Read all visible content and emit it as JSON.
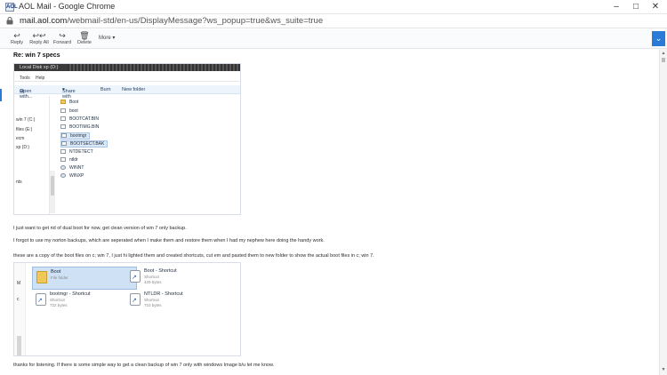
{
  "window": {
    "logo": "AOL",
    "title": "AOL Mail - Google Chrome",
    "url_host": "mail.aol.com",
    "url_path": "/webmail-std/en-us/DisplayMessage?ws_popup=true&ws_suite=true"
  },
  "toolbar": {
    "reply": "Reply",
    "reply_all": "Reply All",
    "forward": "Forward",
    "delete": "Delete",
    "more": "More"
  },
  "message": {
    "subject": "Re: win 7 specs",
    "line1": "I just want to get rid of dual boot for now, get clean version of win 7 only backup.",
    "line2": "I forgot to use my norton backups, which are seperated when I make them and restore them when I had my nephew here doing the handy work.",
    "line3": "these are a copy of the boot files on c; win 7, I just hi lighted them and created shortcuts, cut em and pasted them to new folder to show the actual boot files in c; win 7.",
    "line4": "thanks for listening. If there is some simple way to get a clean backup of win 7 only with windows Image b/u let me know."
  },
  "shot1": {
    "header": "Local Disk xp (D:)",
    "menu": [
      "Tools",
      "Help"
    ],
    "commands": [
      "Open with...",
      "Share with",
      "Burn",
      "New folder"
    ],
    "nav": [
      "win 7 (C:)",
      "files (E:)",
      "ecm",
      "xp (D:)",
      "nts"
    ],
    "files": [
      {
        "name": "Boot",
        "type": "folder",
        "selected": false
      },
      {
        "name": "boot",
        "type": "doc",
        "selected": false
      },
      {
        "name": "BOOTCAT.BIN",
        "type": "doc",
        "selected": false
      },
      {
        "name": "BOOTIMG.BIN",
        "type": "doc",
        "selected": false
      },
      {
        "name": "bootmgr",
        "type": "doc",
        "selected": true
      },
      {
        "name": "BOOTSECT.BAK",
        "type": "doc",
        "selected": true
      },
      {
        "name": "NTDETECT",
        "type": "doc",
        "selected": false
      },
      {
        "name": "ntldr",
        "type": "doc",
        "selected": false
      },
      {
        "name": "WINNT",
        "type": "sys",
        "selected": false
      },
      {
        "name": "WINXP",
        "type": "sys",
        "selected": false
      }
    ]
  },
  "shot2": {
    "side_labels": [
      "M",
      "c"
    ],
    "tiles": [
      {
        "name": "Boot",
        "sub": "File folder",
        "size": "",
        "icon": "folder",
        "selected": true
      },
      {
        "name": "Boot - Shortcut",
        "sub": "Shortcut",
        "size": "429 bytes",
        "icon": "shortcut",
        "selected": false
      },
      {
        "name": "bootmgr - Shortcut",
        "sub": "Shortcut",
        "size": "722 bytes",
        "icon": "shortcut",
        "selected": false
      },
      {
        "name": "NTLDR - Shortcut",
        "sub": "Shortcut",
        "size": "710 bytes",
        "icon": "shortcut",
        "selected": false
      }
    ]
  },
  "colors": {
    "accent": "#2a7bd8"
  }
}
